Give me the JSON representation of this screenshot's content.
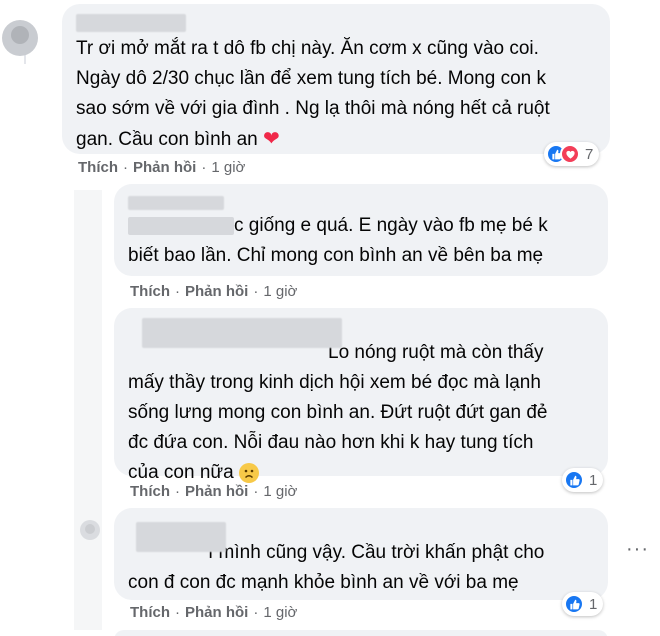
{
  "comments": [
    {
      "text": "Tr ơi mở mắt ra t dô fb chị này. Ăn cơm x cũng vào coi.\nNgày dô 2/30 chục lần để xem tung tích bé. Mong con k\nsao sớm về với gia đình . Ng lạ thôi mà nóng hết cả ruột\ngan. Cầu con bình an",
      "actions": {
        "like": "Thích",
        "reply": "Phản hồi",
        "time": "1 giờ"
      },
      "reactions": {
        "icons": [
          "like-icon",
          "love-icon"
        ],
        "count": "7"
      }
    },
    {
      "text_after_mask": "c giống e quá. E ngày vào fb mẹ bé k\nbiết bao lần. Chỉ mong con bình an về bên ba mẹ",
      "actions": {
        "like": "Thích",
        "reply": "Phản hồi",
        "time": "1 giờ"
      }
    },
    {
      "text_after_mask": "Lo nóng ruột mà còn thấy\nmấy thầy trong kinh dịch hội xem bé đọc mà lạnh\nsống lưng mong con bình an. Đứt ruột đứt gan đẻ\nđc đứa con. Nỗi đau nào hơn khi k hay tung tích\ncủa con nữa",
      "actions": {
        "like": "Thích",
        "reply": "Phản hồi",
        "time": "1 giờ"
      },
      "reactions": {
        "icons": [
          "like-icon"
        ],
        "count": "1"
      }
    },
    {
      "text_after_mask": "ì mình cũng vậy. Cầu trời khấn phật cho\ncon đ con đc mạnh khỏe bình an về với ba mẹ",
      "actions": {
        "like": "Thích",
        "reply": "Phản hồi",
        "time": "1 giờ"
      },
      "reactions": {
        "icons": [
          "like-icon"
        ],
        "count": "1"
      }
    }
  ],
  "colors": {
    "bubble": "#f0f2f5",
    "meta_text": "#65676b",
    "like": "#1877f2",
    "love": "#f33e58"
  }
}
